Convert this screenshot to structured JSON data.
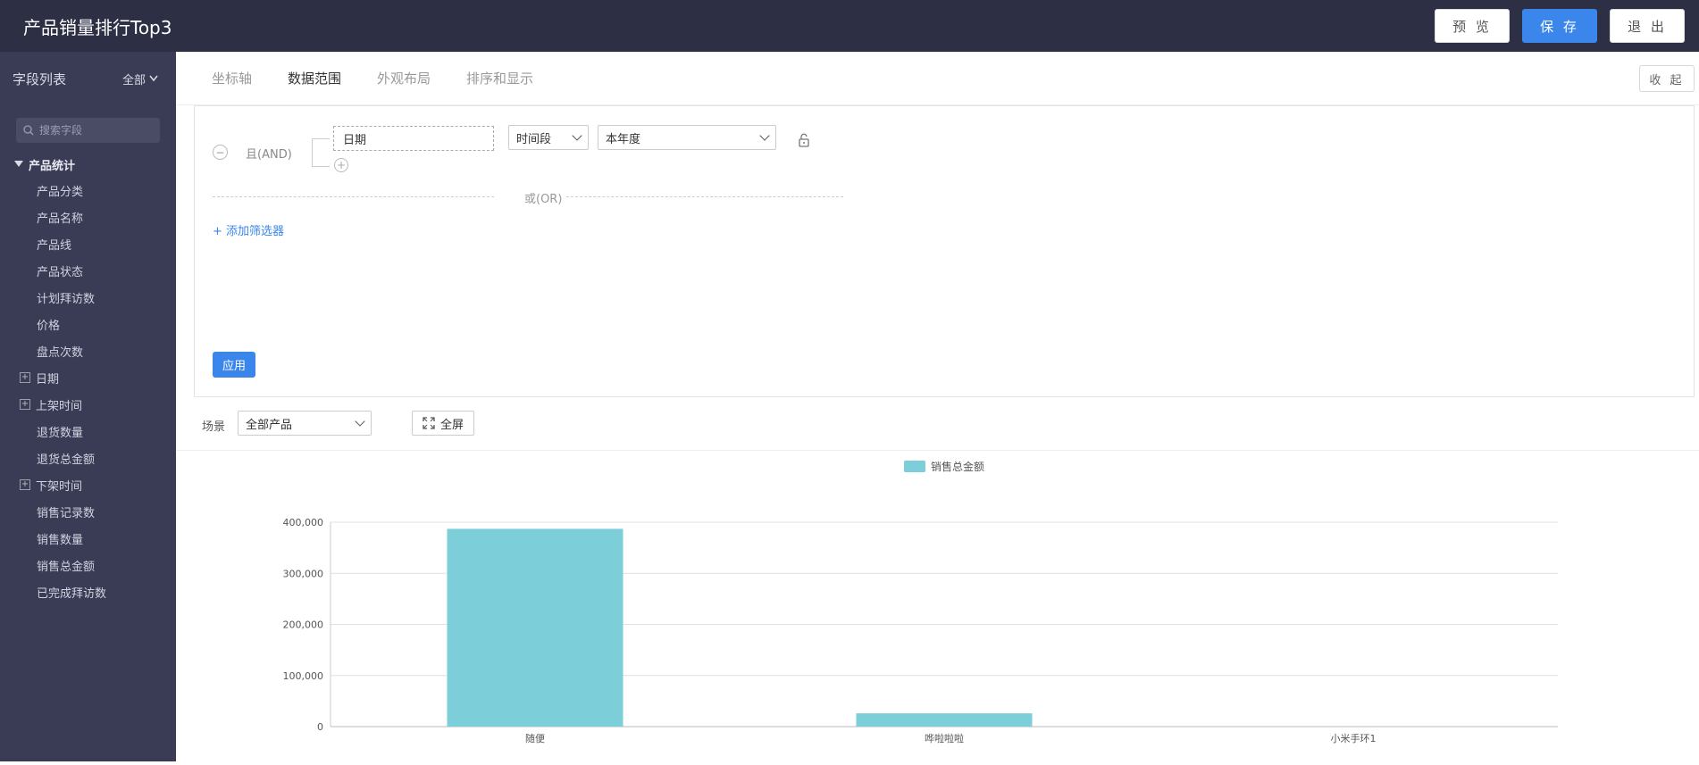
{
  "header": {
    "title": "产品销量排行Top3",
    "preview_label": "预 览",
    "save_label": "保 存",
    "exit_label": "退 出"
  },
  "sidebar": {
    "title": "字段列表",
    "filter_label": "全部",
    "search_placeholder": "搜索字段",
    "group_label": "产品统计",
    "fields": [
      {
        "label": "产品分类",
        "expandable": false
      },
      {
        "label": "产品名称",
        "expandable": false
      },
      {
        "label": "产品线",
        "expandable": false
      },
      {
        "label": "产品状态",
        "expandable": false
      },
      {
        "label": "计划拜访数",
        "expandable": false
      },
      {
        "label": "价格",
        "expandable": false
      },
      {
        "label": "盘点次数",
        "expandable": false
      },
      {
        "label": "日期",
        "expandable": true
      },
      {
        "label": "上架时间",
        "expandable": true
      },
      {
        "label": "退货数量",
        "expandable": false
      },
      {
        "label": "退货总金额",
        "expandable": false
      },
      {
        "label": "下架时间",
        "expandable": true
      },
      {
        "label": "销售记录数",
        "expandable": false
      },
      {
        "label": "销售数量",
        "expandable": false
      },
      {
        "label": "销售总金额",
        "expandable": false
      },
      {
        "label": "已完成拜访数",
        "expandable": false
      }
    ]
  },
  "tabs": [
    "坐标轴",
    "数据范围",
    "外观布局",
    "排序和显示"
  ],
  "active_tab": 1,
  "collapse_label": "收 起",
  "filter": {
    "and_label": "且(AND)",
    "field": "日期",
    "operator": "时间段",
    "value": "本年度",
    "or_label": "或(OR)",
    "add_filter_label": "+ 添加筛选器",
    "apply_label": "应用"
  },
  "scene": {
    "label": "场景",
    "value": "全部产品",
    "fullscreen_label": "全屏"
  },
  "colors": {
    "accent": "#3b86ea",
    "bar": "#7ccfd8",
    "sidebar": "#3a3c55",
    "topbar": "#2d2f45"
  },
  "chart_data": {
    "type": "bar",
    "categories": [
      "随便",
      "哗啦啦啦",
      "小米手环1"
    ],
    "series": [
      {
        "name": "销售总金额",
        "values": [
          387000,
          26000,
          0
        ]
      }
    ],
    "ylim": [
      0,
      400000
    ],
    "yticks": [
      0,
      100000,
      200000,
      300000,
      400000
    ],
    "ytick_labels": [
      "0",
      "100,000",
      "200,000",
      "300,000",
      "400,000"
    ],
    "grid": true,
    "legend_position": "top-center"
  }
}
